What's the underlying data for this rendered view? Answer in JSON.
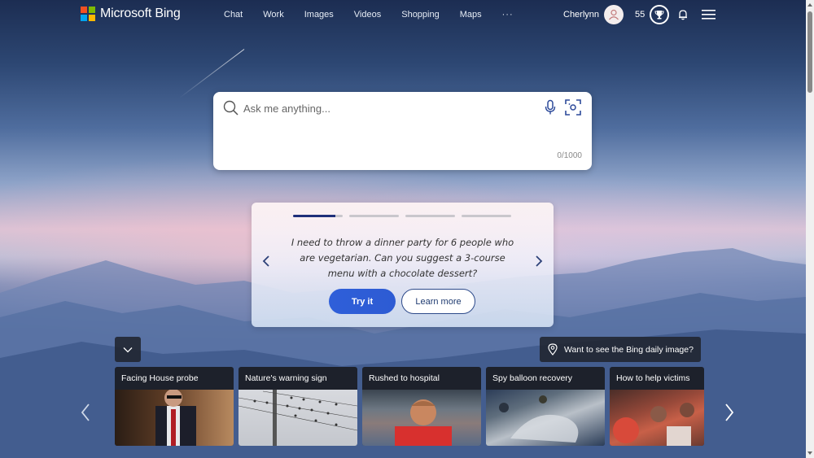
{
  "header": {
    "logo_text": "Microsoft Bing",
    "logo_colors": [
      "#f25022",
      "#7fba00",
      "#00a4ef",
      "#ffb900"
    ],
    "nav": [
      "Chat",
      "Work",
      "Images",
      "Videos",
      "Shopping",
      "Maps"
    ],
    "more_label": "···",
    "user_name": "Cherlynn",
    "reward_points": "55"
  },
  "search": {
    "placeholder": "Ask me anything...",
    "value": "",
    "char_count": "0/1000"
  },
  "carousel": {
    "active_index": 0,
    "slide_count": 4,
    "progress_first_fraction": 0.85,
    "prompt": "I need to throw a dinner party for 6 people who are vegetarian. Can you suggest a 3-course menu with a chocolate dessert?",
    "try_label": "Try it",
    "learn_label": "Learn more"
  },
  "daily_image": {
    "label": "Want to see the Bing daily image?"
  },
  "news": [
    {
      "title": "Facing House probe"
    },
    {
      "title": "Nature's warning sign"
    },
    {
      "title": "Rushed to hospital"
    },
    {
      "title": "Spy balloon recovery"
    },
    {
      "title": "How to help victims"
    }
  ],
  "colors": {
    "accent": "#2f5fd9",
    "progress_active": "#1e2f7a"
  }
}
